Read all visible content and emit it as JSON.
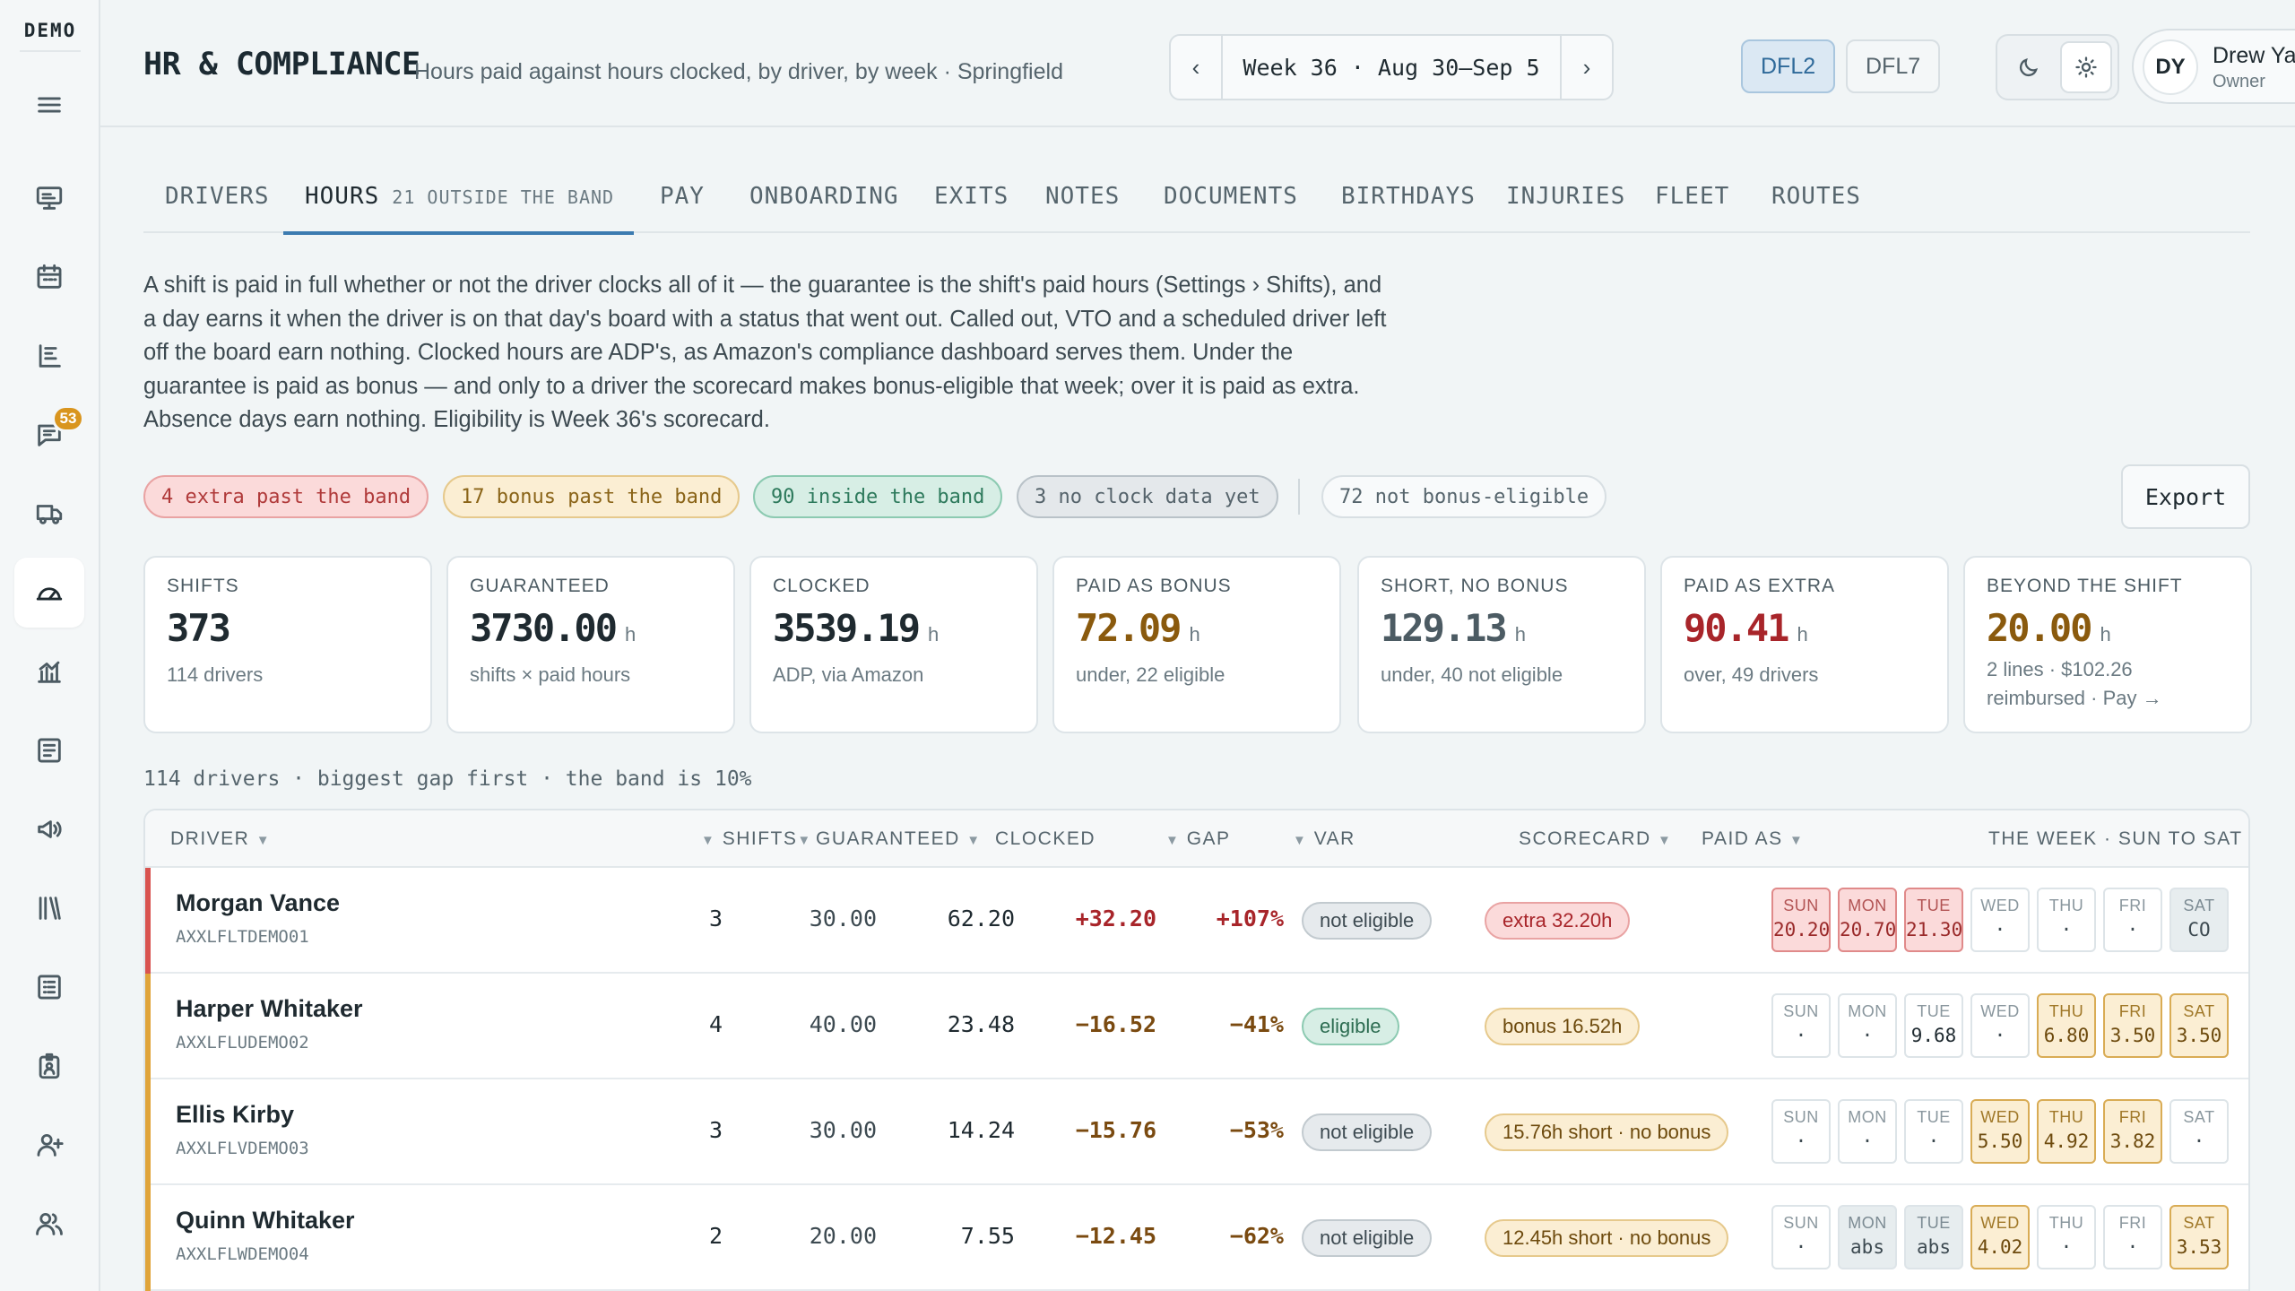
{
  "brand": "DEMO",
  "nav": {
    "messages_badge": "53",
    "icons": [
      "menu-icon",
      "dashboard-icon",
      "calendar-icon",
      "board-icon",
      "messages-icon",
      "truck-icon",
      "gauge-icon",
      "analytics-icon",
      "report-icon",
      "megaphone-icon",
      "library-icon",
      "checklist-icon",
      "badge-icon",
      "add-user-icon",
      "users-icon"
    ]
  },
  "header": {
    "title": "HR & COMPLIANCE",
    "subtitle": "Hours paid against hours clocked, by driver, by week · Springfield",
    "week_label": "Week 36 · Aug 30–Sep 5",
    "prev_arrow": "‹",
    "next_arrow": "›",
    "stations": [
      "DFL2",
      "DFL7"
    ],
    "active_station": "DFL2",
    "user": {
      "initials": "DY",
      "name": "Drew Yates",
      "role": "Owner"
    }
  },
  "tabs": [
    {
      "label": "DRIVERS"
    },
    {
      "label": "HOURS",
      "count": "21 OUTSIDE THE BAND",
      "active": true
    },
    {
      "label": "PAY"
    },
    {
      "label": "ONBOARDING"
    },
    {
      "label": "EXITS"
    },
    {
      "label": "NOTES"
    },
    {
      "label": "DOCUMENTS"
    },
    {
      "label": "BIRTHDAYS"
    },
    {
      "label": "INJURIES"
    },
    {
      "label": "FLEET"
    },
    {
      "label": "ROUTES"
    }
  ],
  "intro": "A shift is paid in full whether or not the driver clocks all of it — the guarantee is the shift's paid hours (Settings › Shifts), and a day earns it when the driver is on that day's board with a status that went out. Called out, VTO and a scheduled driver left off the board earn nothing. Clocked hours are ADP's, as Amazon's compliance dashboard serves them. Under the guarantee is paid as bonus — and only to a driver the scorecard makes bonus-eligible that week; over it is paid as extra. Absence days earn nothing. Eligibility is Week 36's scorecard.",
  "filters": {
    "extra": "4 extra past the band",
    "bonus": "17 bonus past the band",
    "inside": "90 inside the band",
    "no_clock": "3 no clock data yet",
    "not_eligible": "72 not bonus-eligible"
  },
  "export_label": "Export",
  "stats": [
    {
      "label": "SHIFTS",
      "value": "373",
      "unit": "",
      "sub": "114 drivers"
    },
    {
      "label": "GUARANTEED",
      "value": "3730.00",
      "unit": "h",
      "sub": "shifts × paid hours"
    },
    {
      "label": "CLOCKED",
      "value": "3539.19",
      "unit": "h",
      "sub": "ADP, via Amazon"
    },
    {
      "label": "PAID AS BONUS",
      "value": "72.09",
      "unit": "h",
      "sub": "under, 22 eligible"
    },
    {
      "label": "SHORT, NO BONUS",
      "value": "129.13",
      "unit": "h",
      "sub": "under, 40 not eligible"
    },
    {
      "label": "PAID AS EXTRA",
      "value": "90.41",
      "unit": "h",
      "sub": "over, 49 drivers"
    },
    {
      "label": "BEYOND THE SHIFT",
      "value": "20.00",
      "unit": "h",
      "sub": "2 lines · $102.26 reimbursed · Pay →"
    }
  ],
  "table_caption": "114 drivers · biggest gap first · the band is 10%",
  "columns": {
    "driver": "DRIVER",
    "shifts": "SHIFTS",
    "guaranteed": "GUARANTEED",
    "clocked": "CLOCKED",
    "gap": "GAP",
    "var": "VAR",
    "scorecard": "SCORECARD",
    "paid_as": "PAID AS",
    "week": "THE WEEK · SUN TO SAT"
  },
  "colors": {
    "extra_bar": "#d9534f",
    "bonus_bar": "#e0a43a"
  },
  "rows": [
    {
      "name": "Morgan Vance",
      "id": "AXXLFLTDEMO01",
      "shifts": "3",
      "guaranteed": "30.00",
      "clocked": "62.20",
      "gap": "+32.20",
      "var": "+107%",
      "scorecard": "not eligible",
      "paid_as": "extra 32.20h",
      "kind": "extra",
      "days": [
        {
          "d": "SUN",
          "v": "20.20",
          "s": "red"
        },
        {
          "d": "MON",
          "v": "20.70",
          "s": "red"
        },
        {
          "d": "TUE",
          "v": "21.30",
          "s": "red"
        },
        {
          "d": "WED",
          "v": "·",
          "s": ""
        },
        {
          "d": "THU",
          "v": "·",
          "s": ""
        },
        {
          "d": "FRI",
          "v": "·",
          "s": ""
        },
        {
          "d": "SAT",
          "v": "CO",
          "s": "muted"
        }
      ]
    },
    {
      "name": "Harper Whitaker",
      "id": "AXXLFLUDEMO02",
      "shifts": "4",
      "guaranteed": "40.00",
      "clocked": "23.48",
      "gap": "−16.52",
      "var": "−41%",
      "scorecard": "eligible",
      "paid_as": "bonus 16.52h",
      "kind": "bonus",
      "days": [
        {
          "d": "SUN",
          "v": "·",
          "s": ""
        },
        {
          "d": "MON",
          "v": "·",
          "s": ""
        },
        {
          "d": "TUE",
          "v": "9.68",
          "s": "plain-val"
        },
        {
          "d": "WED",
          "v": "·",
          "s": ""
        },
        {
          "d": "THU",
          "v": "6.80",
          "s": "amber"
        },
        {
          "d": "FRI",
          "v": "3.50",
          "s": "amber"
        },
        {
          "d": "SAT",
          "v": "3.50",
          "s": "amber"
        }
      ]
    },
    {
      "name": "Ellis Kirby",
      "id": "AXXLFLVDEMO03",
      "shifts": "3",
      "guaranteed": "30.00",
      "clocked": "14.24",
      "gap": "−15.76",
      "var": "−53%",
      "scorecard": "not eligible",
      "paid_as": "15.76h short · no bonus",
      "kind": "short",
      "days": [
        {
          "d": "SUN",
          "v": "·",
          "s": ""
        },
        {
          "d": "MON",
          "v": "·",
          "s": ""
        },
        {
          "d": "TUE",
          "v": "·",
          "s": ""
        },
        {
          "d": "WED",
          "v": "5.50",
          "s": "amber"
        },
        {
          "d": "THU",
          "v": "4.92",
          "s": "amber"
        },
        {
          "d": "FRI",
          "v": "3.82",
          "s": "amber"
        },
        {
          "d": "SAT",
          "v": "·",
          "s": ""
        }
      ]
    },
    {
      "name": "Quinn Whitaker",
      "id": "AXXLFLWDEMO04",
      "shifts": "2",
      "guaranteed": "20.00",
      "clocked": "7.55",
      "gap": "−12.45",
      "var": "−62%",
      "scorecard": "not eligible",
      "paid_as": "12.45h short · no bonus",
      "kind": "short",
      "days": [
        {
          "d": "SUN",
          "v": "·",
          "s": ""
        },
        {
          "d": "MON",
          "v": "abs",
          "s": "muted"
        },
        {
          "d": "TUE",
          "v": "abs",
          "s": "muted"
        },
        {
          "d": "WED",
          "v": "4.02",
          "s": "amber"
        },
        {
          "d": "THU",
          "v": "·",
          "s": ""
        },
        {
          "d": "FRI",
          "v": "·",
          "s": ""
        },
        {
          "d": "SAT",
          "v": "3.53",
          "s": "amber"
        }
      ]
    }
  ]
}
